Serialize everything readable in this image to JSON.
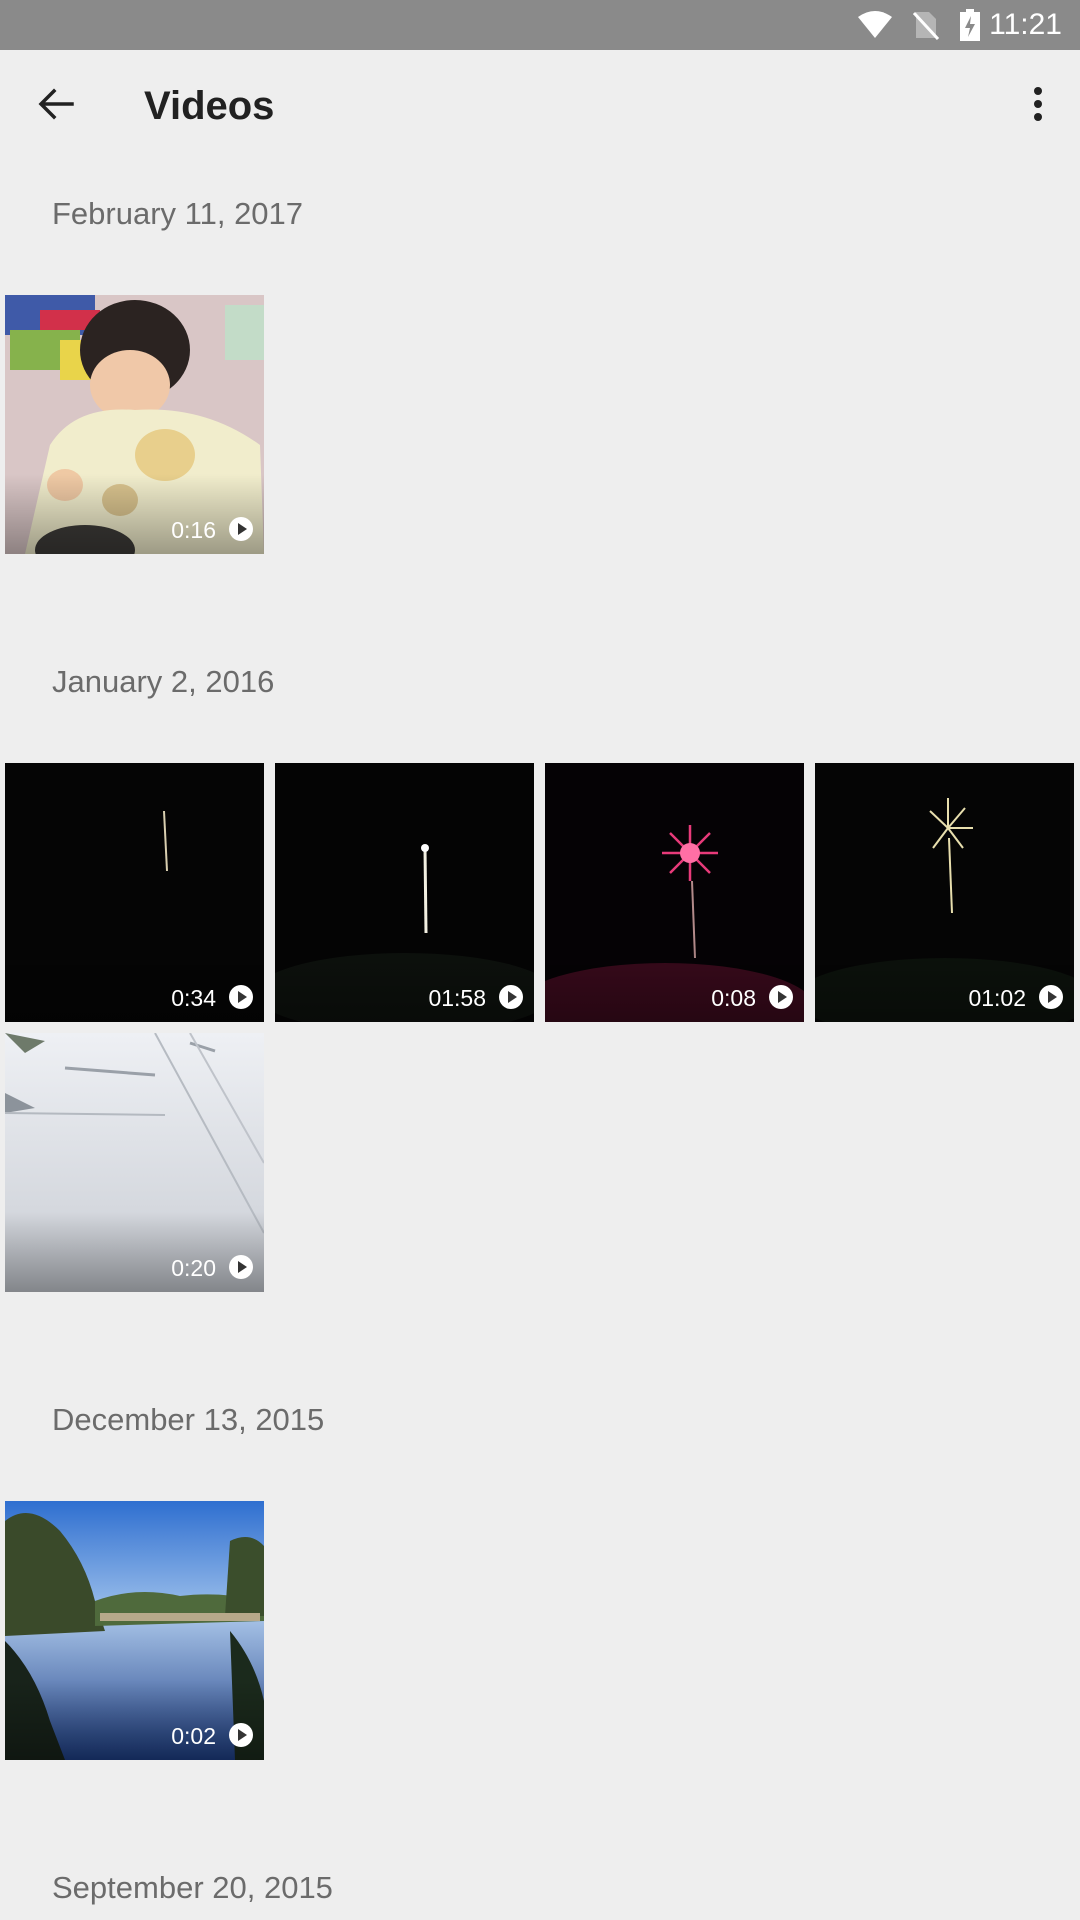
{
  "status_bar": {
    "time": "11:21",
    "icons": [
      "wifi-icon",
      "no-sim-icon",
      "battery-charging-icon"
    ]
  },
  "app_bar": {
    "title": "Videos",
    "back_icon": "arrow-back-icon",
    "more_icon": "more-vert-icon"
  },
  "sections": [
    {
      "date": "February 11, 2017",
      "videos": [
        {
          "duration": "0:16",
          "scene": "baby"
        }
      ]
    },
    {
      "date": "January 2, 2016",
      "videos": [
        {
          "duration": "0:34",
          "scene": "firework-streak"
        },
        {
          "duration": "01:58",
          "scene": "firework-streak-bright"
        },
        {
          "duration": "0:08",
          "scene": "firework-burst-pink"
        },
        {
          "duration": "01:02",
          "scene": "firework-burst-gold"
        },
        {
          "duration": "0:20",
          "scene": "snow"
        }
      ]
    },
    {
      "date": "December 13, 2015",
      "videos": [
        {
          "duration": "0:02",
          "scene": "lake"
        }
      ]
    },
    {
      "date": "September 20, 2015",
      "videos": []
    }
  ],
  "colors": {
    "background": "#eeeeee",
    "status_bar": "#8a8a8a",
    "title_text": "#212121",
    "date_text": "#6b6b6b"
  }
}
